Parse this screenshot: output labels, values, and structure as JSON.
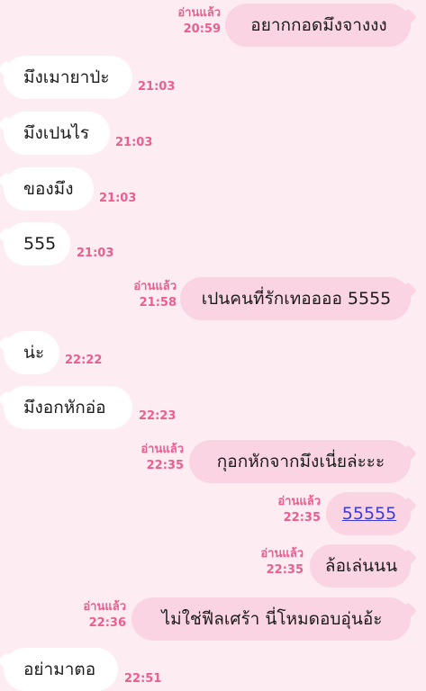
{
  "read_label": "อ่านแล้ว",
  "messages": [
    {
      "dir": "out",
      "text": "อยากกอดมึงจางงง",
      "time": "20:59"
    },
    {
      "dir": "in",
      "text": "มึงเมายาป่ะ",
      "time": "21:03"
    },
    {
      "dir": "in",
      "text": "มึงเปนไร",
      "time": "21:03"
    },
    {
      "dir": "in",
      "text": "ของมึง",
      "time": "21:03"
    },
    {
      "dir": "in",
      "text": "555",
      "time": "21:03"
    },
    {
      "dir": "out",
      "text": "เปนคนที่รักเทออออ 5555",
      "time": "21:58"
    },
    {
      "dir": "in",
      "text": "น่ะ",
      "time": "22:22"
    },
    {
      "dir": "in",
      "text": "มึงอกหักอ่อ",
      "time": "22:23"
    },
    {
      "dir": "out",
      "text": "กุอกหักจากมึงเนี่ยล่ะะะ",
      "time": "22:35"
    },
    {
      "dir": "out",
      "text": "55555",
      "time": "22:35",
      "link": true
    },
    {
      "dir": "out",
      "text": "ล้อเล่นนน",
      "time": "22:35"
    },
    {
      "dir": "out",
      "text": "ไม่ใช่ฟีลเศร้า นี่โหมดอบอุ่นอ้ะ",
      "time": "22:36"
    },
    {
      "dir": "in",
      "text": "อย่ามาตอ",
      "time": "22:51"
    }
  ]
}
